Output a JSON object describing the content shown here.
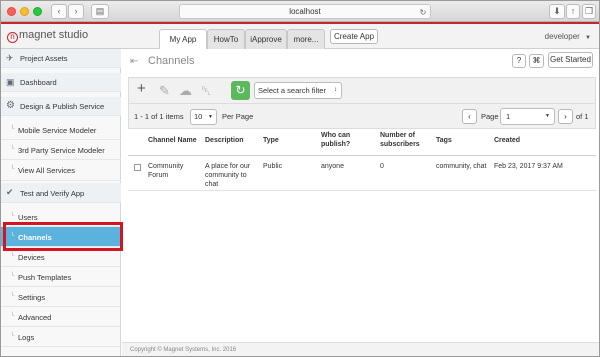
{
  "browser": {
    "url": "localhost"
  },
  "header": {
    "logo_text": "magnet studio",
    "tabs": [
      {
        "label": "My App",
        "active": true
      },
      {
        "label": "HowTo",
        "active": false
      },
      {
        "label": "iApprove",
        "active": false
      },
      {
        "label": "more...",
        "active": false
      }
    ],
    "create_app_label": "Create App",
    "user_label": "developer",
    "help_label": "?",
    "get_started_label": "Get Started"
  },
  "sidebar": {
    "items": [
      {
        "label": "Project Assets",
        "type": "section",
        "icon": "rocket-icon"
      },
      {
        "label": "Dashboard",
        "type": "section",
        "icon": "dashboard-icon"
      },
      {
        "label": "Design & Publish Service",
        "type": "section",
        "icon": "gear-icon"
      },
      {
        "label": "Mobile Service Modeler",
        "type": "sub"
      },
      {
        "label": "3rd Party Service Modeler",
        "type": "sub"
      },
      {
        "label": "View All Services",
        "type": "sub"
      },
      {
        "label": "Test and Verify App",
        "type": "section",
        "icon": "check-circle-icon"
      },
      {
        "label": "Users",
        "type": "sub"
      },
      {
        "label": "Channels",
        "type": "sub",
        "active": true
      },
      {
        "label": "Devices",
        "type": "sub"
      },
      {
        "label": "Push Templates",
        "type": "sub"
      },
      {
        "label": "Settings",
        "type": "sub"
      },
      {
        "label": "Advanced",
        "type": "sub"
      },
      {
        "label": "Logs",
        "type": "sub"
      }
    ]
  },
  "main": {
    "title": "Channels",
    "search_filter_placeholder": "Select a search filter",
    "pager": {
      "range_text": "1 - 1 of 1 items",
      "per_page_value": "10",
      "per_page_label": "Per Page",
      "page_label": "Page",
      "page_value": "1",
      "of_text": "of 1"
    },
    "columns": [
      "Channel Name",
      "Description",
      "Type",
      "Who can publish?",
      "Number of subscribers",
      "Tags",
      "Created"
    ],
    "rows": [
      {
        "channel_name": "Community Forum",
        "description": "A place for our community to chat",
        "type": "Public",
        "who_can_publish": "anyone",
        "subscribers": "0",
        "tags": "community, chat",
        "created": "Feb 23, 2017 9:37 AM"
      }
    ],
    "footer": "Copyright © Magnet Systems, Inc. 2016"
  },
  "colors": {
    "brand_red": "#c6262e",
    "active_item": "#5bb2dc",
    "refresh_green": "#5cb85c",
    "highlight_border": "#d4141e"
  }
}
